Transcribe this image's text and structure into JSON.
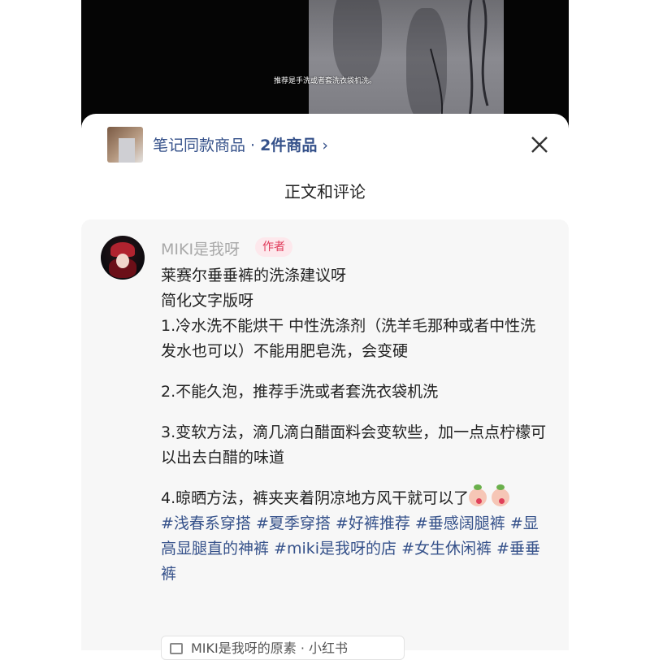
{
  "video": {
    "subtitle": "推荐是手洗或者套洗衣袋机洗。"
  },
  "goods": {
    "label": "笔记同款商品 · ",
    "count": "2件商品",
    "chevron": "›"
  },
  "section_title": "正文和评论",
  "comment": {
    "author": "MIKI是我呀",
    "badge": "作者",
    "title": "莱赛尔垂垂裤的洗涤建议呀",
    "subtitle": "简化文字版呀",
    "p1": "1.冷水洗不能烘干  中性洗涤剂（洗羊毛那种或者中性洗发水也可以）不能用肥皂洗，会变硬",
    "p2": "2.不能久泡，推荐手洗或者套洗衣袋机洗",
    "p3": "3.变软方法，滴几滴白醋面料会变软些，加一点点柠檬可以出去白醋的味道",
    "p4": "4.晾晒方法，裤夹夹着阴凉地方风干就可以了",
    "tags": "#浅春系穿搭 #夏季穿搭 #好裤推荐 #垂感阔腿裤 #显高显腿直的神裤 #miki是我呀的店 #女生休闲裤 #垂垂裤",
    "shop_chip": "MIKI是我呀的原素 · 小红书"
  },
  "icons": {
    "close": "close-icon",
    "emoji": "peach-emoji-icon",
    "cart": "cart-icon"
  },
  "colors": {
    "link": "#35518a",
    "badge_bg": "#fde8ec",
    "badge_text": "#e03a5a",
    "card_bg": "#f7f7f7"
  }
}
